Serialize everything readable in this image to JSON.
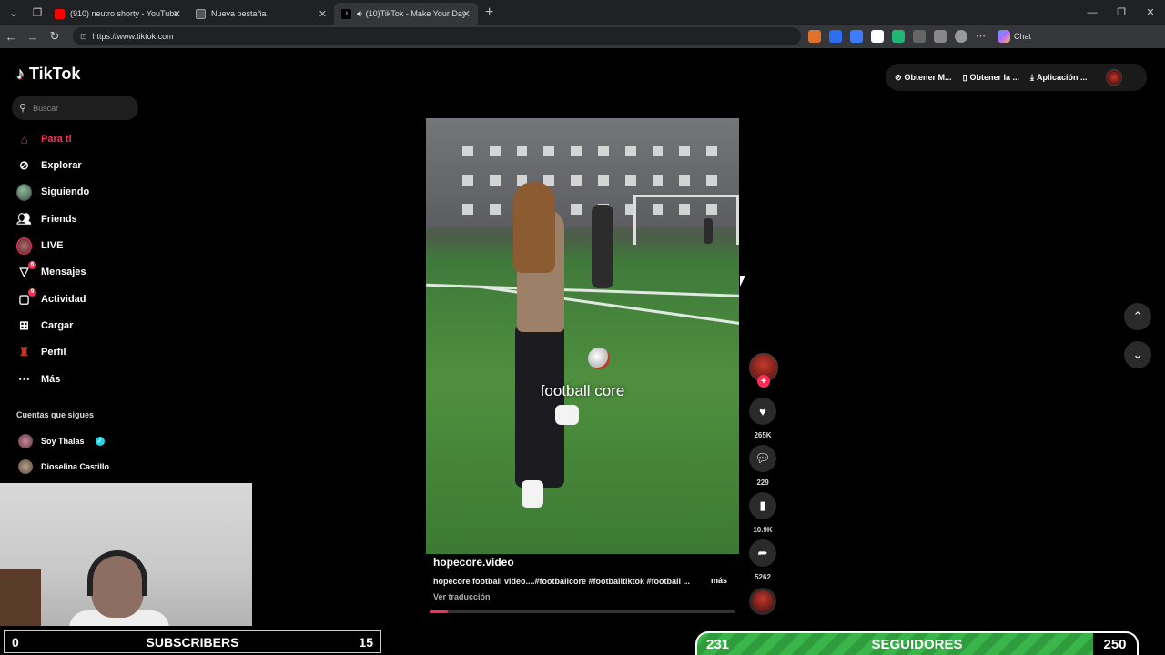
{
  "browser": {
    "tabs": [
      {
        "label": "(910) neutro shorty - YouTube",
        "color": "#ff0000"
      },
      {
        "label": "Nueva pestaña",
        "color": "#888888"
      },
      {
        "label": "(10)TikTok - Make Your Day",
        "color": "#ffffff"
      }
    ],
    "url": "https://www.tiktok.com",
    "chat_label": "Chat"
  },
  "sidebar": {
    "brand": "TikTok",
    "search_placeholder": "Buscar",
    "nav": [
      {
        "label": "Para ti",
        "icon": "home-icon"
      },
      {
        "label": "Explorar",
        "icon": "compass-icon"
      },
      {
        "label": "Siguiendo",
        "icon": "following-avatar"
      },
      {
        "label": "Friends",
        "icon": "friends-icon"
      },
      {
        "label": "LIVE",
        "icon": "live-avatar"
      },
      {
        "label": "Mensajes",
        "icon": "send-icon",
        "badge": "6"
      },
      {
        "label": "Actividad",
        "icon": "activity-icon",
        "badge": "9"
      },
      {
        "label": "Cargar",
        "icon": "upload-icon"
      },
      {
        "label": "Perfil",
        "icon": "profile-icon"
      },
      {
        "label": "Más",
        "icon": "more-icon"
      }
    ],
    "following_title": "Cuentas que sigues",
    "following": [
      {
        "name": "Soy Thalas",
        "verified": true
      },
      {
        "name": "Dioselina Castillo",
        "verified": false
      }
    ]
  },
  "video": {
    "overlay_text": "football core",
    "author": "hopecore.video",
    "description": "hopecore football video....#footballcore #footballtiktok #football ...",
    "more_label": "más",
    "translate_label": "Ver traducción",
    "progress": 0.06
  },
  "actions": {
    "likes": "265K",
    "comments": "229",
    "saves": "10.9K",
    "shares": "5262"
  },
  "top_right": {
    "items": [
      "Obtener M...",
      "Obtener la ...",
      "Aplicación ..."
    ]
  },
  "stream_overlay": {
    "subs_left": "0",
    "subs_label": "SUBSCRIBERS",
    "subs_right": "15",
    "seg_left": "231",
    "seg_label": "SEGUIDORES",
    "seg_right": "250"
  }
}
